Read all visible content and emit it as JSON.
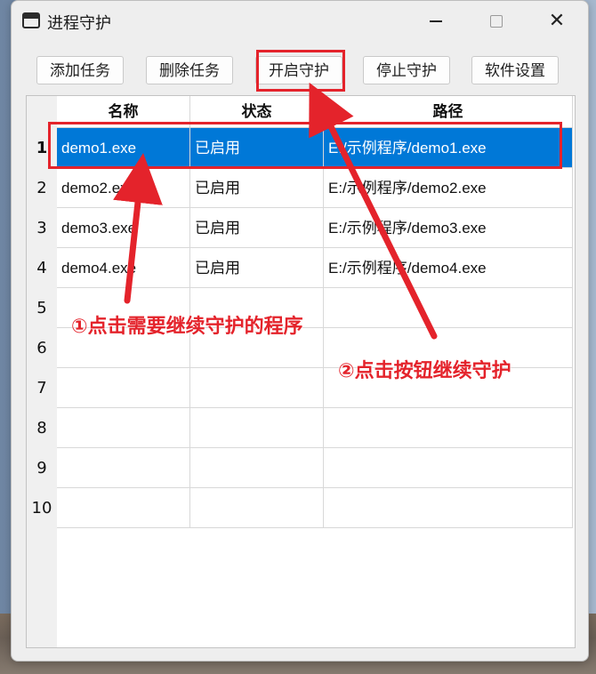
{
  "window": {
    "title": "进程守护",
    "minimize_glyph": "",
    "close_glyph": "✕"
  },
  "toolbar": {
    "buttons": [
      {
        "label": "添加任务"
      },
      {
        "label": "删除任务"
      },
      {
        "label": "开启守护"
      },
      {
        "label": "停止守护"
      },
      {
        "label": "软件设置"
      }
    ]
  },
  "table": {
    "columns": [
      "名称",
      "状态",
      "路径"
    ],
    "selected_row": 1,
    "rows": [
      {
        "num": "1",
        "name": "demo1.exe",
        "status": "已启用",
        "path": "E:/示例程序/demo1.exe"
      },
      {
        "num": "2",
        "name": "demo2.exe",
        "status": "已启用",
        "path": "E:/示例程序/demo2.exe"
      },
      {
        "num": "3",
        "name": "demo3.exe",
        "status": "已启用",
        "path": "E:/示例程序/demo3.exe"
      },
      {
        "num": "4",
        "name": "demo4.exe",
        "status": "已启用",
        "path": "E:/示例程序/demo4.exe"
      },
      {
        "num": "5",
        "name": "",
        "status": "",
        "path": ""
      },
      {
        "num": "6",
        "name": "",
        "status": "",
        "path": ""
      },
      {
        "num": "7",
        "name": "",
        "status": "",
        "path": ""
      },
      {
        "num": "8",
        "name": "",
        "status": "",
        "path": ""
      },
      {
        "num": "9",
        "name": "",
        "status": "",
        "path": ""
      },
      {
        "num": "10",
        "name": "",
        "status": "",
        "path": ""
      }
    ]
  },
  "annotations": {
    "step1": "①点击需要继续守护的程序",
    "step2": "②点击按钮继续守护"
  },
  "colors": {
    "selection": "#0078d7",
    "annotation_red": "#e4232b"
  }
}
